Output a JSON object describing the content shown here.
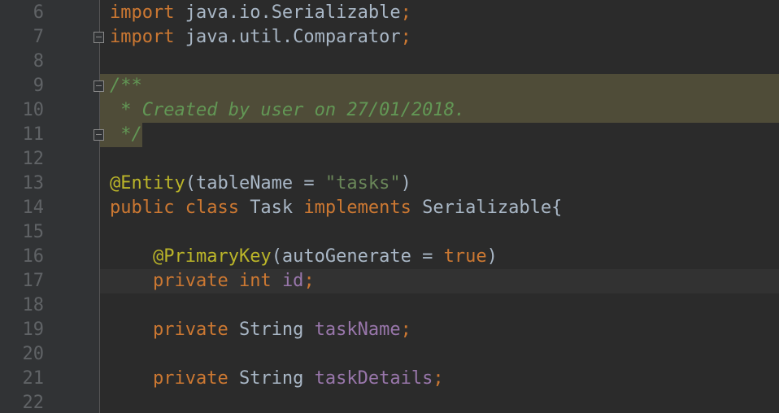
{
  "editor": {
    "lines": [
      {
        "number": "6",
        "tokens": [
          {
            "t": "import",
            "c": "kw"
          },
          {
            "t": " java.io.Serializable",
            "c": "plain"
          },
          {
            "t": ";",
            "c": "kw"
          }
        ]
      },
      {
        "number": "7",
        "tokens": [
          {
            "t": "import",
            "c": "kw"
          },
          {
            "t": " java.util.Comparator",
            "c": "plain"
          },
          {
            "t": ";",
            "c": "kw"
          }
        ]
      },
      {
        "number": "8",
        "tokens": []
      },
      {
        "number": "9",
        "tokens": [
          {
            "t": "/**",
            "c": "doc"
          }
        ]
      },
      {
        "number": "10",
        "tokens": [
          {
            "t": " * Created by user on 27/01/2018.",
            "c": "doc"
          }
        ]
      },
      {
        "number": "11",
        "tokens": [
          {
            "t": " */",
            "c": "doc"
          }
        ]
      },
      {
        "number": "12",
        "tokens": []
      },
      {
        "number": "13",
        "tokens": [
          {
            "t": "@Entity",
            "c": "ann"
          },
          {
            "t": "(tableName = ",
            "c": "plain"
          },
          {
            "t": "\"tasks\"",
            "c": "str"
          },
          {
            "t": ")",
            "c": "plain"
          }
        ]
      },
      {
        "number": "14",
        "tokens": [
          {
            "t": "public class ",
            "c": "kw"
          },
          {
            "t": "Task ",
            "c": "plain"
          },
          {
            "t": "implements ",
            "c": "kw"
          },
          {
            "t": "Serializable{",
            "c": "plain"
          }
        ]
      },
      {
        "number": "15",
        "tokens": []
      },
      {
        "number": "16",
        "tokens": [
          {
            "t": "    ",
            "c": "plain"
          },
          {
            "t": "@PrimaryKey",
            "c": "ann"
          },
          {
            "t": "(autoGenerate = ",
            "c": "plain"
          },
          {
            "t": "true",
            "c": "kw"
          },
          {
            "t": ")",
            "c": "plain"
          }
        ]
      },
      {
        "number": "17",
        "tokens": [
          {
            "t": "    ",
            "c": "plain"
          },
          {
            "t": "private int ",
            "c": "kw"
          },
          {
            "t": "id",
            "c": "field"
          },
          {
            "t": ";",
            "c": "kw"
          }
        ]
      },
      {
        "number": "18",
        "tokens": []
      },
      {
        "number": "19",
        "tokens": [
          {
            "t": "    ",
            "c": "plain"
          },
          {
            "t": "private ",
            "c": "kw"
          },
          {
            "t": "String ",
            "c": "plain"
          },
          {
            "t": "taskName",
            "c": "field"
          },
          {
            "t": ";",
            "c": "kw"
          }
        ]
      },
      {
        "number": "20",
        "tokens": []
      },
      {
        "number": "21",
        "tokens": [
          {
            "t": "    ",
            "c": "plain"
          },
          {
            "t": "private ",
            "c": "kw"
          },
          {
            "t": "String ",
            "c": "plain"
          },
          {
            "t": "taskDetails",
            "c": "field"
          },
          {
            "t": ";",
            "c": "kw"
          }
        ]
      },
      {
        "number": "22",
        "tokens": []
      }
    ],
    "caret_line": "17",
    "highlighted_lines": [
      "9",
      "10",
      "11"
    ],
    "fold_marker_lines": [
      "7",
      "9",
      "11"
    ],
    "colors": {
      "background": "#2b2b2b",
      "gutter": "#313335",
      "keyword": "#cc7832",
      "annotation": "#bbb529",
      "string": "#6a8759",
      "field": "#9876aa",
      "doc_comment": "#629755",
      "plain": "#a9b7c6",
      "line_number": "#606366",
      "highlight": "#4f4c38"
    }
  }
}
